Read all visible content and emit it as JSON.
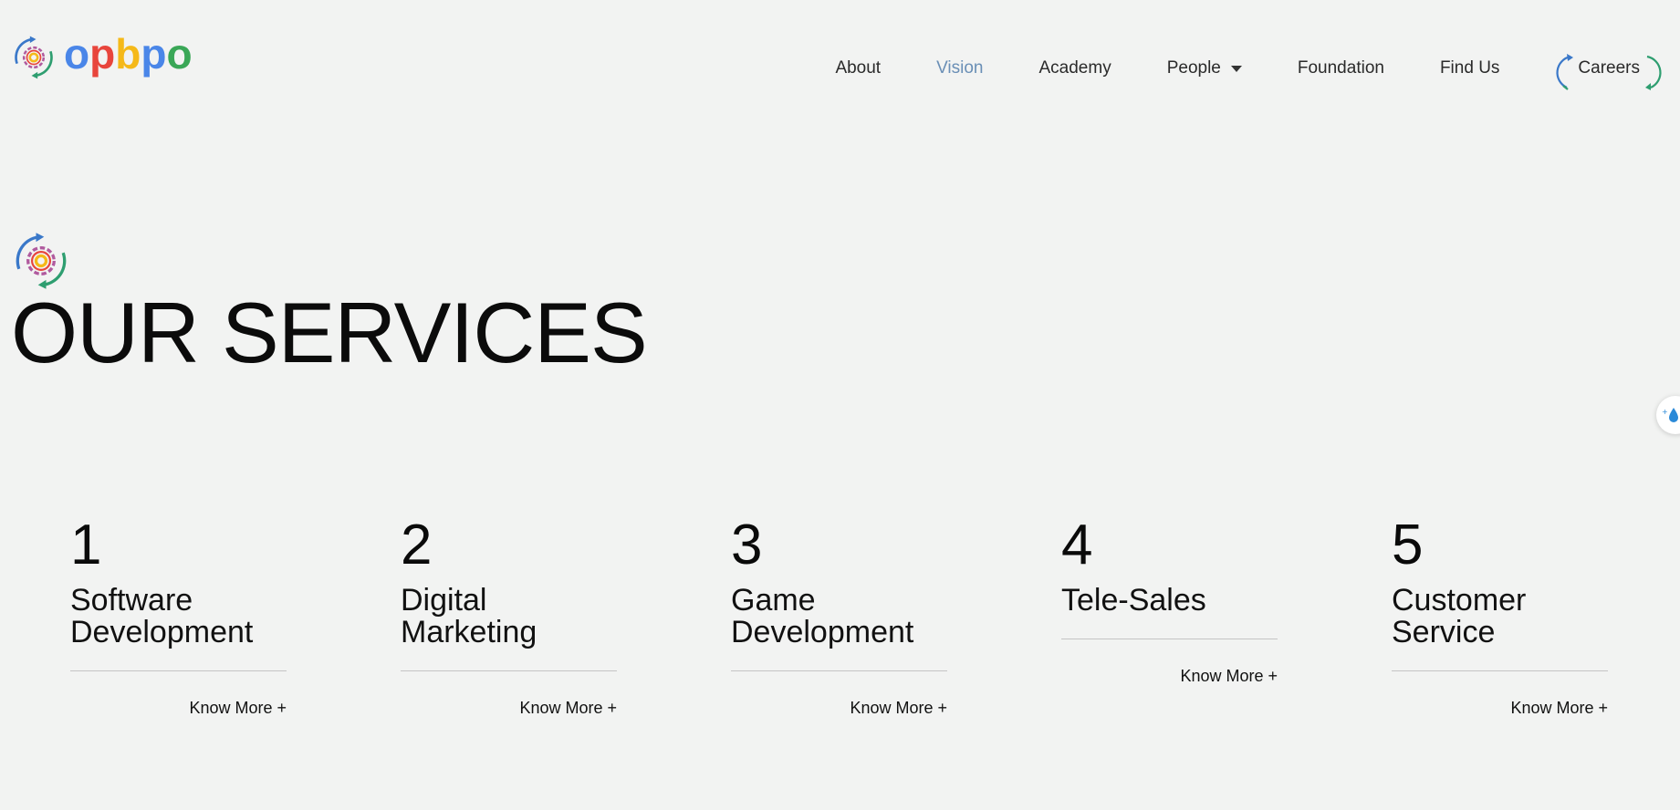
{
  "brand": {
    "letters": [
      {
        "char": "o",
        "color": "#4a86e8"
      },
      {
        "char": "p",
        "color": "#e8453c"
      },
      {
        "char": "b",
        "color": "#f5b919"
      },
      {
        "char": "p",
        "color": "#4a86e8"
      },
      {
        "char": "o",
        "color": "#3aa757"
      }
    ]
  },
  "nav": {
    "items": [
      {
        "label": "About",
        "active": false
      },
      {
        "label": "Vision",
        "active": true
      },
      {
        "label": "Academy",
        "active": false
      },
      {
        "label": "People",
        "active": false,
        "dropdown": true
      },
      {
        "label": "Foundation",
        "active": false
      },
      {
        "label": "Find Us",
        "active": false
      },
      {
        "label": "Careers",
        "active": false
      }
    ]
  },
  "section": {
    "title": "OUR SERVICES"
  },
  "services": [
    {
      "number": "1",
      "title_line1": "Software",
      "title_line2": "Development",
      "link": "Know More +"
    },
    {
      "number": "2",
      "title_line1": "Digital",
      "title_line2": "Marketing",
      "link": "Know More +"
    },
    {
      "number": "3",
      "title_line1": "Game",
      "title_line2": "Development",
      "link": "Know More +"
    },
    {
      "number": "4",
      "title_line1": "Tele-Sales",
      "title_line2": "",
      "link": "Know More +"
    },
    {
      "number": "5",
      "title_line1": "Customer",
      "title_line2": "Service",
      "link": "Know More +"
    }
  ],
  "colors": {
    "background": "#f2f3f2",
    "active_nav": "#6a8fb6",
    "rule": "#c4c4c4"
  }
}
